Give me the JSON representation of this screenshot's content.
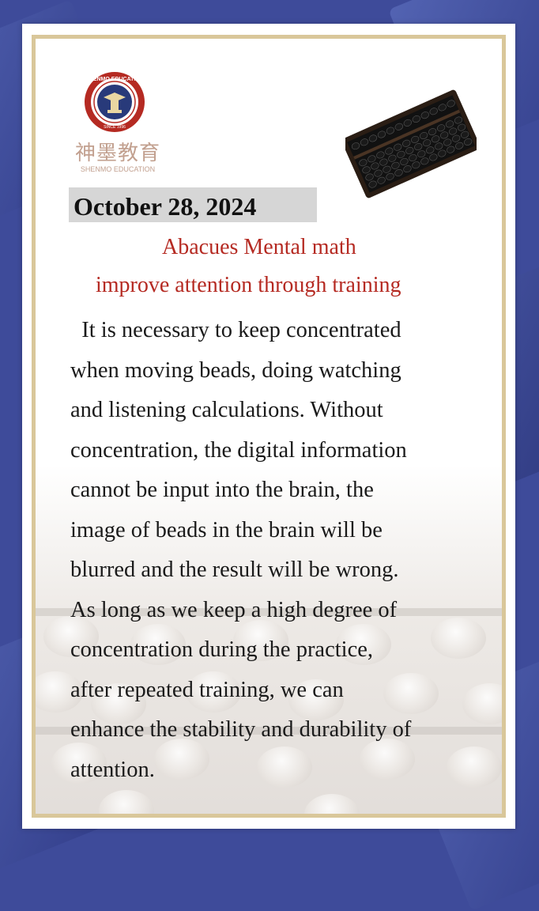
{
  "logo": {
    "seal_text": "SHENMO EDUCATION",
    "seal_year": "SINCE 1996",
    "chinese_name": "神墨教育",
    "english_name": "SHENMO EDUCATION"
  },
  "date": "October 28, 2024",
  "title": {
    "line1": "Abacues Mental math",
    "line2": "improve attention through training"
  },
  "body_lines": [
    "  It is necessary to keep concentrated",
    "when moving beads, doing watching",
    "and listening calculations. Without",
    "concentration, the digital information",
    "cannot be input into the brain, the",
    "image of beads in the brain will be",
    "blurred and the result will be wrong.",
    "As long as we keep a high degree of",
    "concentration during the practice,",
    "after repeated training, we can",
    "enhance the stability and durability of",
    "attention."
  ],
  "colors": {
    "background": "#3e4b9a",
    "frame": "#d9c79a",
    "title_red": "#b52a22",
    "logo_red": "#b52a22",
    "date_highlight": "#d6d6d6"
  }
}
